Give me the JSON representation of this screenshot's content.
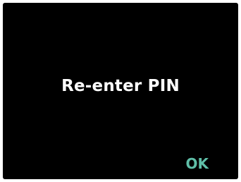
{
  "screen": {
    "prompt": "Re-enter PIN",
    "ok_label": "OK"
  },
  "colors": {
    "background": "#000000",
    "prompt_text": "#ffffff",
    "ok_accent": "#5fbfa8"
  }
}
